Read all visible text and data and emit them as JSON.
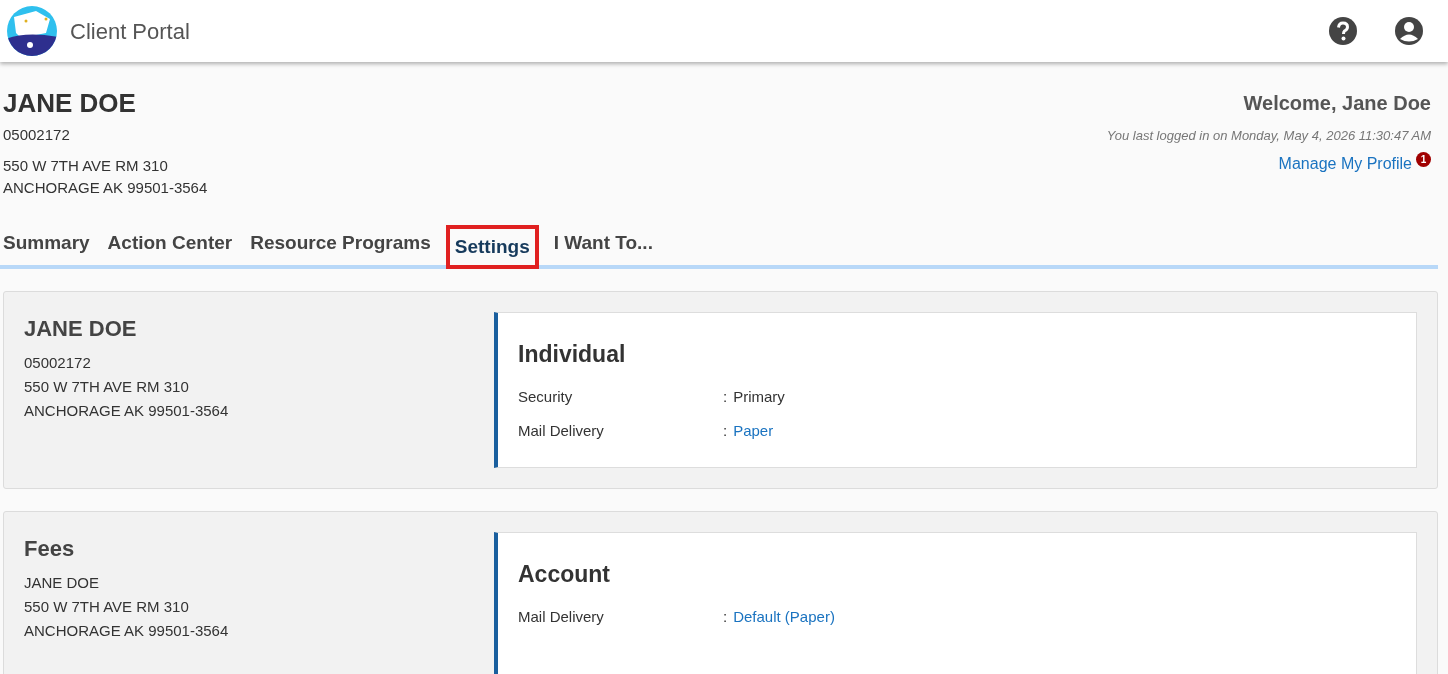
{
  "header": {
    "title": "Client Portal"
  },
  "client": {
    "name": "JANE DOE",
    "id": "05002172",
    "address_lines": [
      "550 W 7TH AVE RM 310",
      "ANCHORAGE AK 99501-3564"
    ]
  },
  "welcome": {
    "greeting": "Welcome, Jane Doe",
    "last_login": "You last logged in on Monday, May 4, 2026 11:30:47 AM",
    "profile_link": "Manage My Profile",
    "notification_count": "1"
  },
  "tabs": [
    {
      "label": "Summary",
      "selected": false
    },
    {
      "label": "Action Center",
      "selected": false
    },
    {
      "label": "Resource Programs",
      "selected": false
    },
    {
      "label": "Settings",
      "selected": true
    },
    {
      "label": "I Want To...",
      "selected": false
    }
  ],
  "cards": [
    {
      "heading": "JANE DOE",
      "lines": [
        "05002172",
        "550 W 7TH AVE RM 310",
        "ANCHORAGE AK 99501-3564"
      ],
      "panel_title": "Individual",
      "fields": [
        {
          "label": "Security",
          "separator": ":",
          "value": "Primary",
          "link": false
        },
        {
          "label": "Mail Delivery",
          "separator": ":",
          "value": "Paper",
          "link": true
        }
      ]
    },
    {
      "heading": "Fees",
      "lines": [
        "JANE DOE",
        "550 W 7TH AVE RM 310",
        "ANCHORAGE AK 99501-3564"
      ],
      "panel_title": "Account",
      "fields": [
        {
          "label": "Mail Delivery",
          "separator": ":",
          "value": "Default (Paper)",
          "link": true
        }
      ]
    }
  ]
}
